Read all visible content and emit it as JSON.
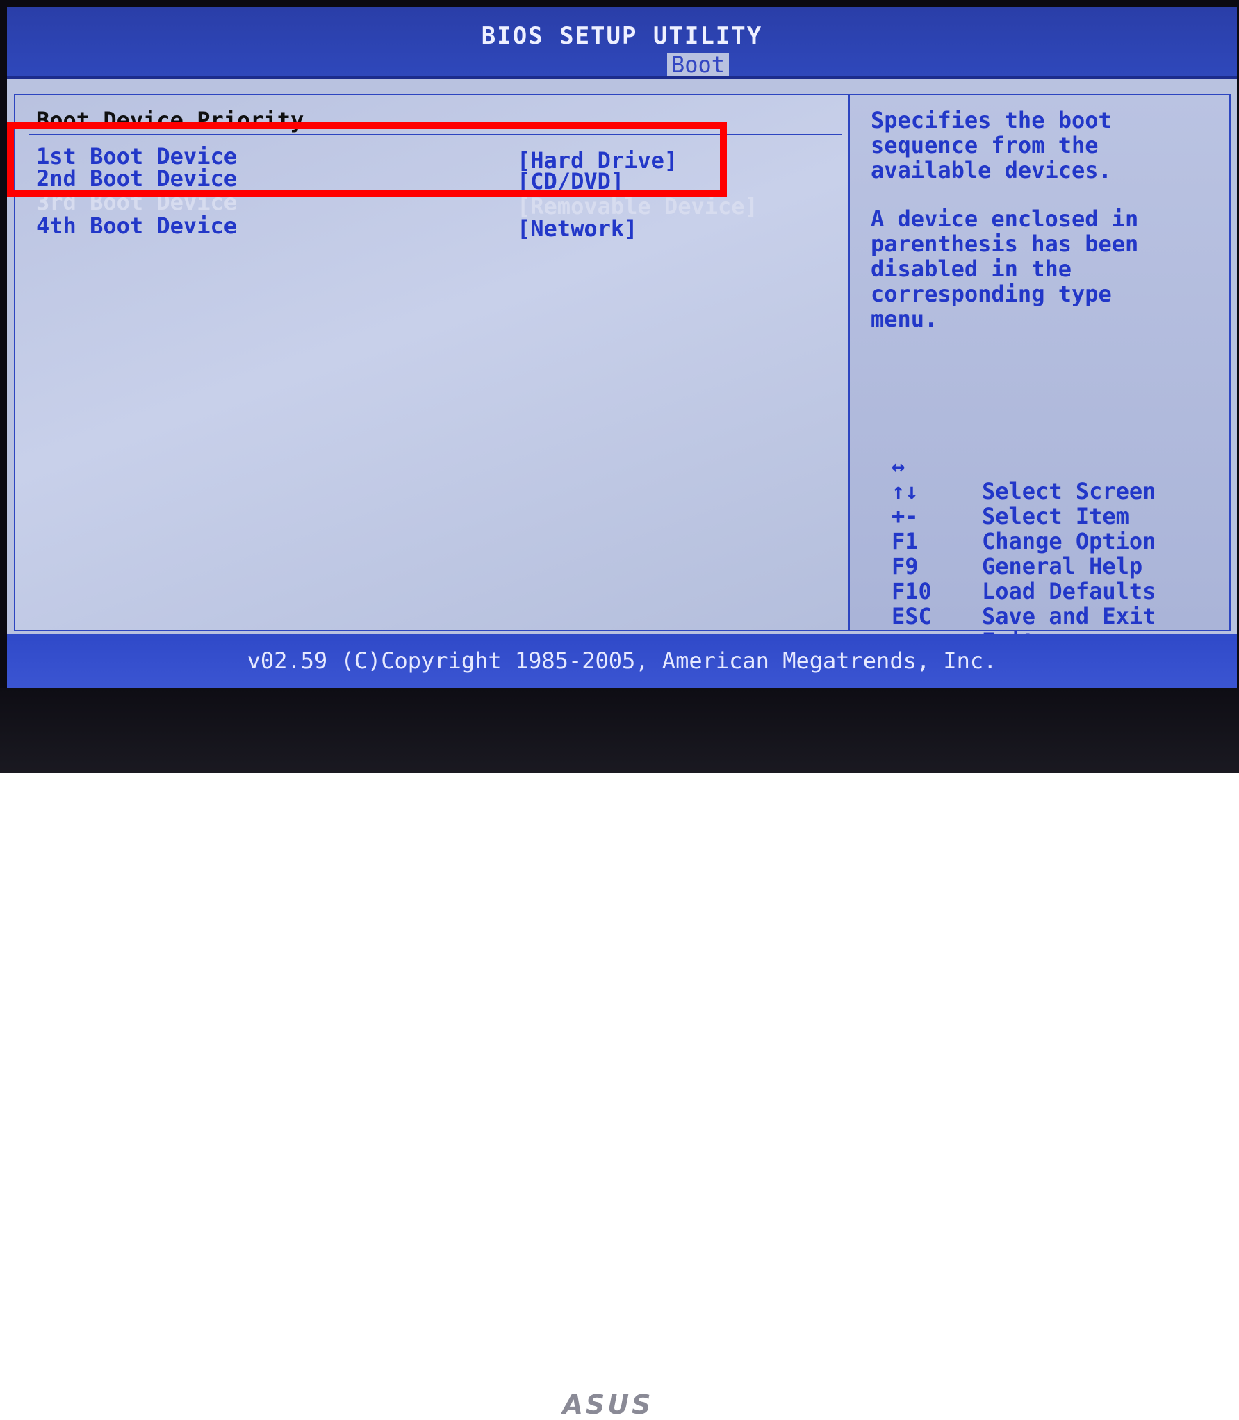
{
  "title": "BIOS SETUP UTILITY",
  "active_tab": "Boot",
  "section": {
    "title": "Boot Device Priority",
    "rows": [
      {
        "label": "1st Boot Device",
        "value": "[Hard Drive]",
        "state": "selected"
      },
      {
        "label": "2nd Boot Device",
        "value": "[CD/DVD]",
        "state": "normal"
      },
      {
        "label": "3rd Boot Device",
        "value": "[Removable Device]",
        "state": "highlighted"
      },
      {
        "label": "4th Boot Device",
        "value": "[Network]",
        "state": "normal"
      }
    ]
  },
  "help": {
    "lines": [
      "Specifies the boot",
      "sequence from the",
      "available devices.",
      "",
      "A device enclosed in",
      "parenthesis has been",
      "disabled in the",
      "corresponding type",
      "menu."
    ],
    "keys": [
      {
        "key": "↔",
        "action": "Select Screen"
      },
      {
        "key": "↑↓",
        "action": "Select Item"
      },
      {
        "key": "+-",
        "action": "Change Option"
      },
      {
        "key": "F1",
        "action": "General Help"
      },
      {
        "key": "F9",
        "action": "Load Defaults"
      },
      {
        "key": "F10",
        "action": "Save and Exit"
      },
      {
        "key": "ESC",
        "action": "Exit"
      }
    ]
  },
  "footer": "v02.59 (C)Copyright 1985-2005, American Megatrends, Inc.",
  "bezel_logo": "ASUS",
  "colors": {
    "bios_blue": "#2f48bb",
    "panel_bg": "#b9c2e0",
    "text_blue": "#2237c8",
    "highlight_red": "#ff0000"
  }
}
